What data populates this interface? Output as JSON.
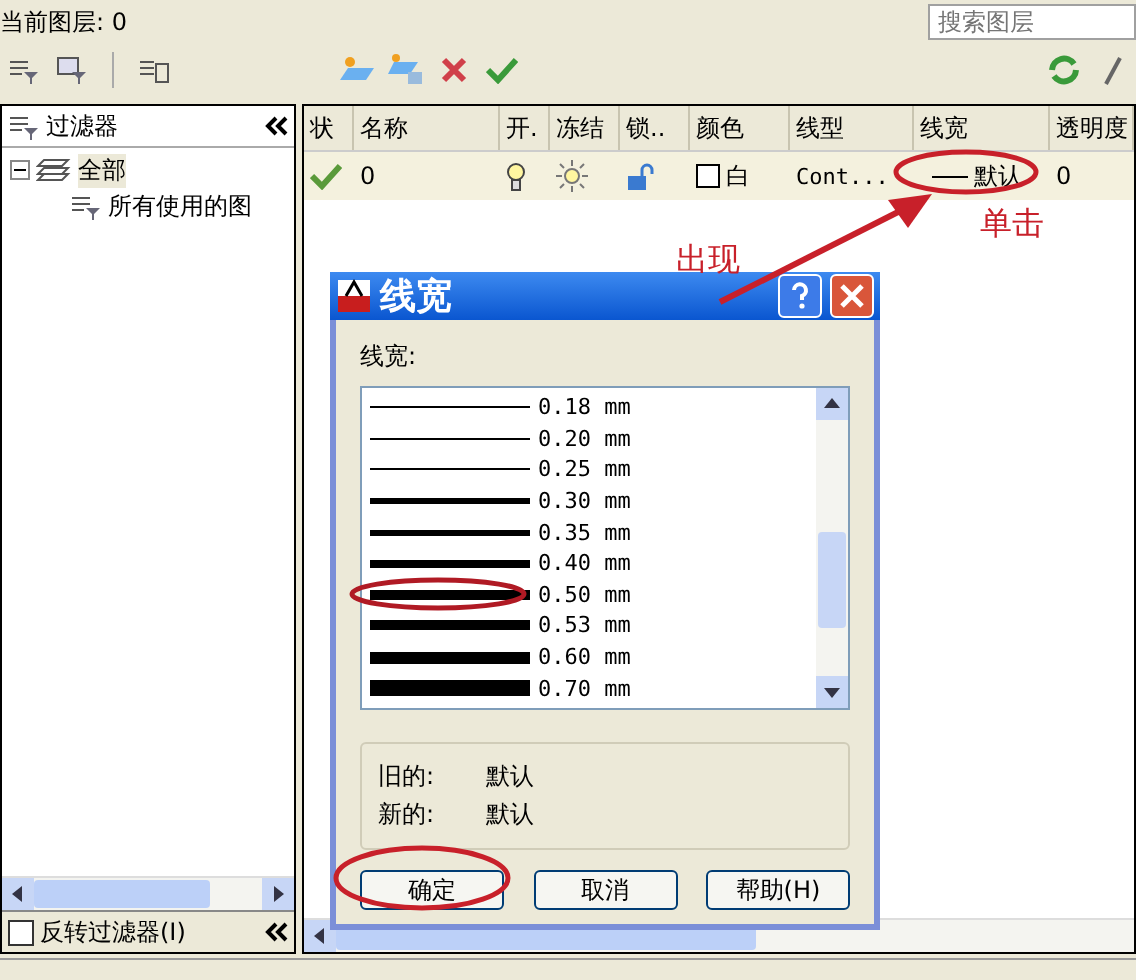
{
  "current_layer": {
    "label": "当前图层: 0"
  },
  "search": {
    "placeholder": "搜索图层"
  },
  "filter_panel": {
    "title": "过滤器",
    "tree": [
      {
        "label": "全部",
        "expanded": true,
        "children": [
          {
            "label": "所有使用的图"
          }
        ]
      }
    ],
    "invert_filter": {
      "label": "反转过滤器(I)",
      "checked": false
    }
  },
  "layer_table": {
    "columns": [
      "状",
      "名称",
      "开.",
      "冻结",
      "锁..",
      "颜色",
      "线型",
      "线宽",
      "透明度"
    ],
    "rows": [
      {
        "current": true,
        "name": "0",
        "on": true,
        "frozen": false,
        "locked": false,
        "color_name": "白",
        "linetype": "Cont...",
        "lineweight": "默认",
        "transparency": "0"
      }
    ]
  },
  "dialog": {
    "title": "线宽",
    "list_label": "线宽:",
    "lineweights": [
      {
        "label": "0.18 mm",
        "kind": "thin"
      },
      {
        "label": "0.20 mm",
        "kind": "thin"
      },
      {
        "label": "0.25 mm",
        "kind": "thin"
      },
      {
        "label": "0.30 mm",
        "kind": "medium"
      },
      {
        "label": "0.35 mm",
        "kind": "medium"
      },
      {
        "label": "0.40 mm",
        "kind": "bold"
      },
      {
        "label": "0.50 mm",
        "kind": "heavy"
      },
      {
        "label": "0.53 mm",
        "kind": "heavy"
      },
      {
        "label": "0.60 mm",
        "kind": "heavier"
      },
      {
        "label": "0.70 mm",
        "kind": "heaviest"
      }
    ],
    "old": {
      "label": "旧的:",
      "value": "默认"
    },
    "new": {
      "label": "新的:",
      "value": "默认"
    },
    "buttons": [
      "确定",
      "取消",
      "帮助(H)"
    ]
  },
  "annotations": [
    {
      "text": "出现"
    },
    {
      "text": "单击"
    }
  ]
}
